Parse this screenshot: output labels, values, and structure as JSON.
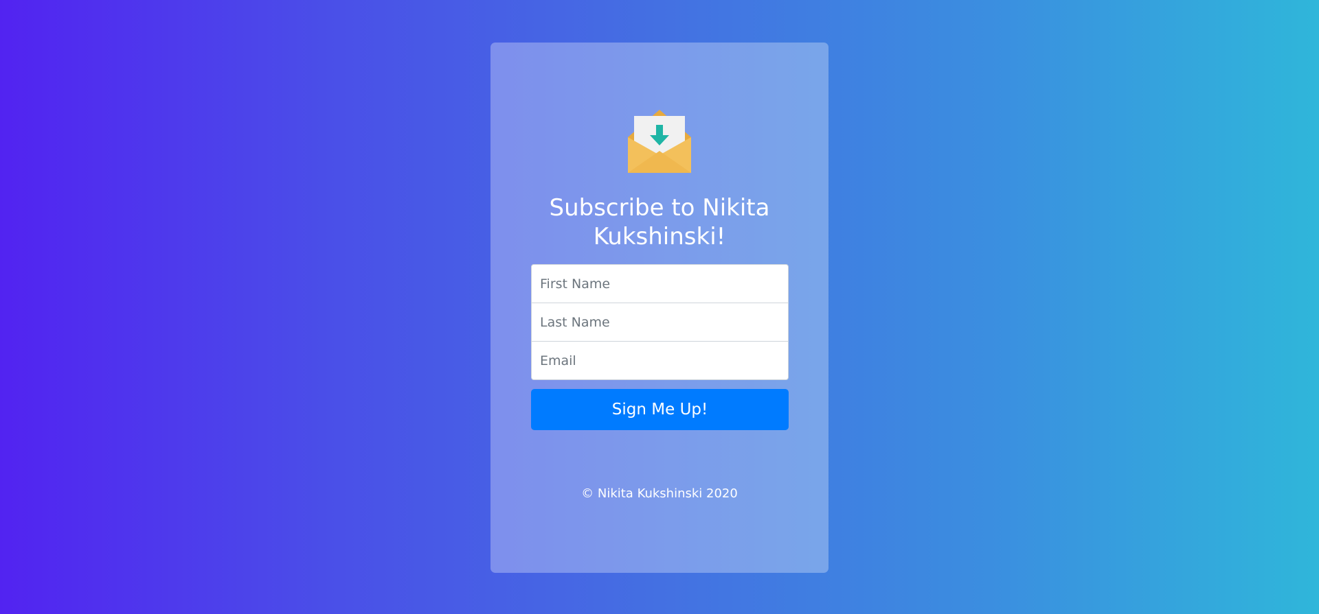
{
  "page": {
    "title": "Subscribe to Nikita Kukshinski!",
    "footer": "© Nikita Kukshinski 2020"
  },
  "form": {
    "first_name_placeholder": "First Name",
    "last_name_placeholder": "Last Name",
    "email_placeholder": "Email",
    "submit_label": "Sign Me Up!"
  },
  "icons": {
    "logo": "mail-download-icon"
  },
  "colors": {
    "gradient_start": "#5223f1",
    "gradient_end": "#2fb6da",
    "button": "#007bff",
    "envelope": "#f3c05b",
    "arrow": "#1fb5a5"
  }
}
